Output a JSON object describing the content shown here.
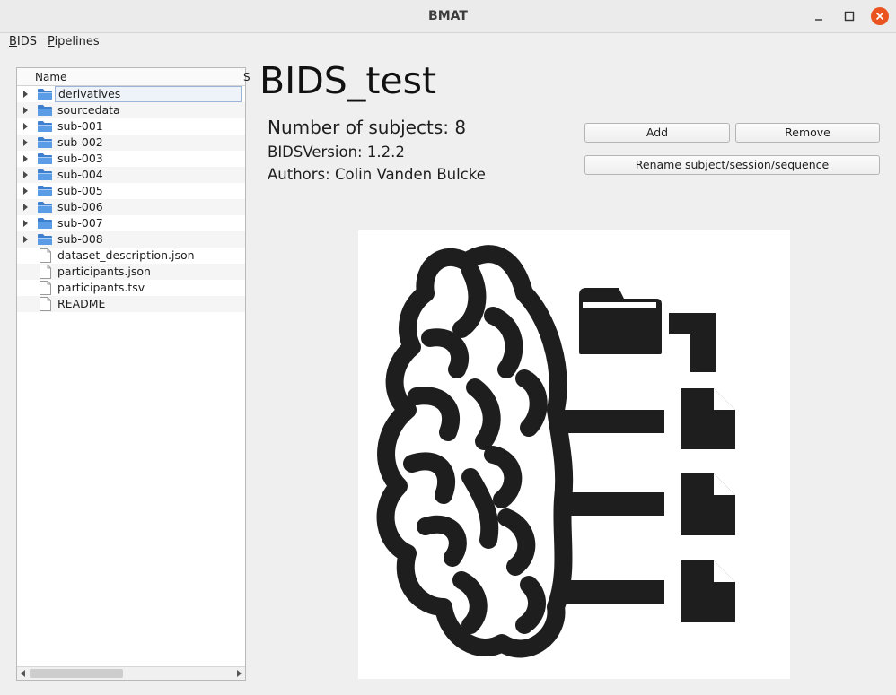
{
  "window": {
    "title": "BMAT"
  },
  "menubar": {
    "items": [
      {
        "label": "BIDS",
        "mnemonic": "B",
        "rest": "IDS"
      },
      {
        "label": "Pipelines",
        "mnemonic": "P",
        "rest": "ipelines"
      }
    ]
  },
  "tree": {
    "columns": [
      "Name",
      "S"
    ],
    "rows": [
      {
        "label": "derivatives",
        "type": "folder",
        "selected": true
      },
      {
        "label": "sourcedata",
        "type": "folder"
      },
      {
        "label": "sub-001",
        "type": "folder"
      },
      {
        "label": "sub-002",
        "type": "folder"
      },
      {
        "label": "sub-003",
        "type": "folder"
      },
      {
        "label": "sub-004",
        "type": "folder"
      },
      {
        "label": "sub-005",
        "type": "folder"
      },
      {
        "label": "sub-006",
        "type": "folder"
      },
      {
        "label": "sub-007",
        "type": "folder"
      },
      {
        "label": "sub-008",
        "type": "folder"
      },
      {
        "label": "dataset_description.json",
        "type": "file"
      },
      {
        "label": "participants.json",
        "type": "file"
      },
      {
        "label": "participants.tsv",
        "type": "file"
      },
      {
        "label": "README",
        "type": "file"
      }
    ]
  },
  "dataset": {
    "name": "BIDS_test",
    "subjects_text": "Number of subjects: 8",
    "version_text": "BIDSVersion: 1.2.2",
    "authors_text": "Authors: Colin Vanden Bulcke"
  },
  "buttons": {
    "add": "Add",
    "remove": "Remove",
    "rename": "Rename subject/session/sequence"
  },
  "colors": {
    "close_button": "#e95420",
    "folder_blue": "#4f8fd6",
    "logo_ink": "#1e1e1e"
  },
  "icons": {
    "logo": "brain-with-folder-and-files-logo",
    "folder": "folder-icon",
    "file": "file-icon"
  }
}
